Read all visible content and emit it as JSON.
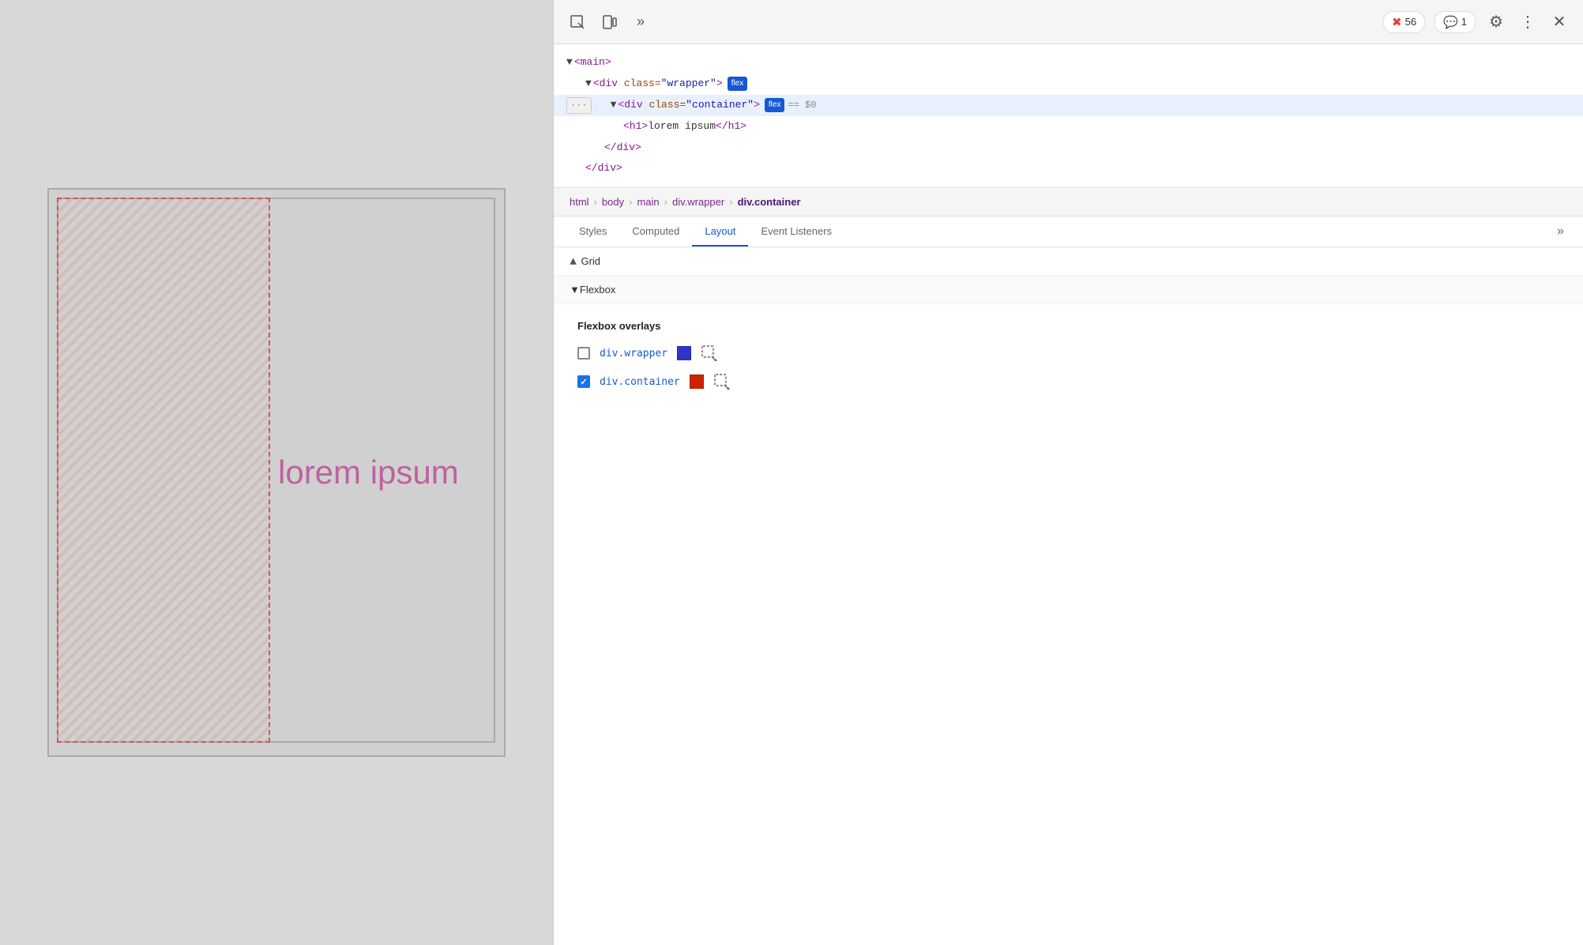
{
  "viewport": {
    "lorem_text": "lorem ipsum"
  },
  "devtools": {
    "toolbar": {
      "inspect_icon": "⬚",
      "device_icon": "📱",
      "more_tools_icon": "»",
      "error_count": "56",
      "console_count": "1",
      "gear_icon": "⚙",
      "more_icon": "⋮",
      "close_icon": "✕"
    },
    "html_tree": {
      "nodes": [
        {
          "indent": 0,
          "content": "▼<main>",
          "selected": false
        },
        {
          "indent": 1,
          "content": "▼<div class=\"wrapper\">",
          "has_flex_badge": true,
          "selected": false
        },
        {
          "indent": 2,
          "content": "▼<div class=\"container\">",
          "has_flex_badge": true,
          "is_selected": true,
          "has_eq": true
        },
        {
          "indent": 3,
          "content": "<h1>lorem ipsum</h1>",
          "selected": false
        },
        {
          "indent": 2,
          "content": "</div>",
          "selected": false
        },
        {
          "indent": 1,
          "content": "</div>",
          "selected": false
        }
      ]
    },
    "breadcrumb": {
      "items": [
        "html",
        "body",
        "main",
        "div.wrapper",
        "div.container"
      ]
    },
    "tabs": {
      "items": [
        "Styles",
        "Computed",
        "Layout",
        "Event Listeners"
      ],
      "active": "Layout"
    },
    "layout": {
      "grid_section": {
        "label": "Grid",
        "collapsed": true
      },
      "flexbox_section": {
        "label": "Flexbox",
        "overlays_title": "Flexbox overlays",
        "overlays": [
          {
            "checked": false,
            "name": "div.wrapper",
            "color": "#3333cc",
            "has_icon": true
          },
          {
            "checked": true,
            "name": "div.container",
            "color": "#cc2200",
            "has_icon": true
          }
        ]
      }
    }
  }
}
